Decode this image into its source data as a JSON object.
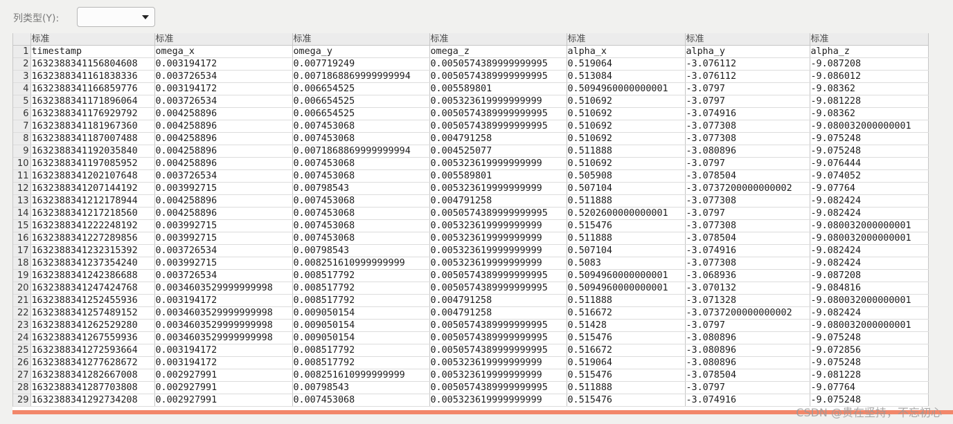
{
  "header": {
    "column_type_label": "列类型(Y):",
    "column_type_value": ""
  },
  "grid": {
    "column_types": [
      "标准",
      "标准",
      "标准",
      "标准",
      "标准",
      "标准",
      "标准"
    ],
    "rows": [
      [
        "timestamp",
        "omega_x",
        "omega_y",
        "omega_z",
        "alpha_x",
        "alpha_y",
        "alpha_z"
      ],
      [
        "1632388341156804608",
        "0.003194172",
        "0.007719249",
        "0.0050574389999999995",
        "0.519064",
        "-3.076112",
        "-9.087208"
      ],
      [
        "1632388341161838336",
        "0.003726534",
        "0.0071868869999999994",
        "0.0050574389999999995",
        "0.513084",
        "-3.076112",
        "-9.086012"
      ],
      [
        "1632388341166859776",
        "0.003194172",
        "0.006654525",
        "0.005589801",
        "0.5094960000000001",
        "-3.0797",
        "-9.08362"
      ],
      [
        "1632388341171896064",
        "0.003726534",
        "0.006654525",
        "0.005323619999999999",
        "0.510692",
        "-3.0797",
        "-9.081228"
      ],
      [
        "1632388341176929792",
        "0.004258896",
        "0.006654525",
        "0.0050574389999999995",
        "0.510692",
        "-3.074916",
        "-9.08362"
      ],
      [
        "1632388341181967360",
        "0.004258896",
        "0.007453068",
        "0.0050574389999999995",
        "0.510692",
        "-3.077308",
        "-9.080032000000001"
      ],
      [
        "1632388341187007488",
        "0.004258896",
        "0.007453068",
        "0.004791258",
        "0.510692",
        "-3.077308",
        "-9.075248"
      ],
      [
        "1632388341192035840",
        "0.004258896",
        "0.0071868869999999994",
        "0.004525077",
        "0.511888",
        "-3.080896",
        "-9.075248"
      ],
      [
        "1632388341197085952",
        "0.004258896",
        "0.007453068",
        "0.005323619999999999",
        "0.510692",
        "-3.0797",
        "-9.076444"
      ],
      [
        "1632388341202107648",
        "0.003726534",
        "0.007453068",
        "0.005589801",
        "0.505908",
        "-3.078504",
        "-9.074052"
      ],
      [
        "1632388341207144192",
        "0.003992715",
        "0.00798543",
        "0.005323619999999999",
        "0.507104",
        "-3.0737200000000002",
        "-9.07764"
      ],
      [
        "1632388341212178944",
        "0.004258896",
        "0.007453068",
        "0.004791258",
        "0.511888",
        "-3.077308",
        "-9.082424"
      ],
      [
        "1632388341217218560",
        "0.004258896",
        "0.007453068",
        "0.0050574389999999995",
        "0.5202600000000001",
        "-3.0797",
        "-9.082424"
      ],
      [
        "1632388341222248192",
        "0.003992715",
        "0.007453068",
        "0.005323619999999999",
        "0.515476",
        "-3.077308",
        "-9.080032000000001"
      ],
      [
        "1632388341227289856",
        "0.003992715",
        "0.007453068",
        "0.005323619999999999",
        "0.511888",
        "-3.078504",
        "-9.080032000000001"
      ],
      [
        "1632388341232315392",
        "0.003726534",
        "0.00798543",
        "0.005323619999999999",
        "0.507104",
        "-3.074916",
        "-9.082424"
      ],
      [
        "1632388341237354240",
        "0.003992715",
        "0.008251610999999999",
        "0.005323619999999999",
        "0.5083",
        "-3.077308",
        "-9.082424"
      ],
      [
        "1632388341242386688",
        "0.003726534",
        "0.008517792",
        "0.0050574389999999995",
        "0.5094960000000001",
        "-3.068936",
        "-9.087208"
      ],
      [
        "1632388341247424768",
        "0.0034603529999999998",
        "0.008517792",
        "0.0050574389999999995",
        "0.5094960000000001",
        "-3.070132",
        "-9.084816"
      ],
      [
        "1632388341252455936",
        "0.003194172",
        "0.008517792",
        "0.004791258",
        "0.511888",
        "-3.071328",
        "-9.080032000000001"
      ],
      [
        "1632388341257489152",
        "0.0034603529999999998",
        "0.009050154",
        "0.004791258",
        "0.516672",
        "-3.0737200000000002",
        "-9.082424"
      ],
      [
        "1632388341262529280",
        "0.0034603529999999998",
        "0.009050154",
        "0.0050574389999999995",
        "0.51428",
        "-3.0797",
        "-9.080032000000001"
      ],
      [
        "1632388341267559936",
        "0.0034603529999999998",
        "0.009050154",
        "0.0050574389999999995",
        "0.515476",
        "-3.080896",
        "-9.075248"
      ],
      [
        "1632388341272593664",
        "0.003194172",
        "0.008517792",
        "0.0050574389999999995",
        "0.516672",
        "-3.080896",
        "-9.072856"
      ],
      [
        "1632388341277628672",
        "0.003194172",
        "0.008517792",
        "0.005323619999999999",
        "0.519064",
        "-3.080896",
        "-9.075248"
      ],
      [
        "1632388341282667008",
        "0.002927991",
        "0.008251610999999999",
        "0.005323619999999999",
        "0.515476",
        "-3.078504",
        "-9.081228"
      ],
      [
        "1632388341287703808",
        "0.002927991",
        "0.00798543",
        "0.0050574389999999995",
        "0.511888",
        "-3.0797",
        "-9.07764"
      ],
      [
        "1632388341292734208",
        "0.002927991",
        "0.007453068",
        "0.005323619999999999",
        "0.515476",
        "-3.074916",
        "-9.075248"
      ]
    ]
  },
  "watermark": "CSDN @贵在坚持，不忘初心",
  "accent_color": "#f2876a"
}
